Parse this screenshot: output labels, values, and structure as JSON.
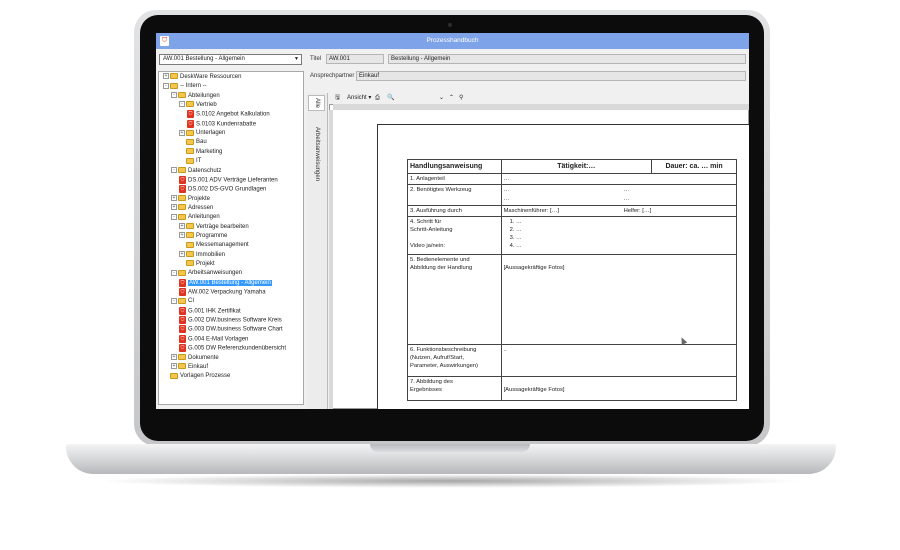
{
  "window": {
    "title": "Prozesshandbuch",
    "app_icon": "app-logo-icon"
  },
  "selector": {
    "value": "AW.001 Bestellung - Allgemein"
  },
  "tree": [
    {
      "label": "DeskWare Ressourcen",
      "type": "folder",
      "expander": "+"
    },
    {
      "label": "-- Intern --",
      "type": "folder",
      "expander": "-"
    },
    {
      "label": "Abteilungen",
      "type": "folder",
      "expander": "-"
    },
    {
      "label": "Vertrieb",
      "type": "folder",
      "expander": "-"
    },
    {
      "label": "S.0102 Angebot Kalkulation",
      "type": "doc"
    },
    {
      "label": "S.0103 Kundenrabatte",
      "type": "doc"
    },
    {
      "label": "Unterlagen",
      "type": "folder",
      "expander": "+"
    },
    {
      "label": "Bau",
      "type": "folder",
      "expander": ""
    },
    {
      "label": "Marketing",
      "type": "folder",
      "expander": ""
    },
    {
      "label": "IT",
      "type": "folder",
      "expander": ""
    },
    {
      "label": "Datenschutz",
      "type": "folder",
      "expander": "-"
    },
    {
      "label": "DS.001 ADV Verträge Lieferanten",
      "type": "doc"
    },
    {
      "label": "DS.002 DS-GVO Grundlagen",
      "type": "doc"
    },
    {
      "label": "Projekte",
      "type": "folder",
      "expander": "+"
    },
    {
      "label": "Adressen",
      "type": "folder",
      "expander": "+"
    },
    {
      "label": "Anleitungen",
      "type": "folder",
      "expander": "-"
    },
    {
      "label": "Verträge bearbeiten",
      "type": "folder",
      "expander": "+"
    },
    {
      "label": "Programme",
      "type": "folder",
      "expander": "+"
    },
    {
      "label": "Messemanagement",
      "type": "folder",
      "expander": ""
    },
    {
      "label": "Immobilien",
      "type": "folder",
      "expander": "+"
    },
    {
      "label": "Projekt",
      "type": "folder",
      "expander": ""
    },
    {
      "label": "Arbeitsanweisungen",
      "type": "folder",
      "expander": "-"
    },
    {
      "label": "AW.001 Bestellung - Allgemein",
      "type": "doc",
      "selected": true
    },
    {
      "label": "AW.002 Verpackung Yamaha",
      "type": "doc"
    },
    {
      "label": "CI",
      "type": "folder",
      "expander": "-"
    },
    {
      "label": "G.001 IHK Zertifikat",
      "type": "doc"
    },
    {
      "label": "G.002 DW.business Software Kreis",
      "type": "doc"
    },
    {
      "label": "G.003 DW.business Software Chart",
      "type": "doc"
    },
    {
      "label": "G.004 E-Mail Vorlagen",
      "type": "doc"
    },
    {
      "label": "G.005 DW Referenzkundenübersicht",
      "type": "doc"
    },
    {
      "label": "Dokumente",
      "type": "folder",
      "expander": "+"
    },
    {
      "label": "Einkauf",
      "type": "folder",
      "expander": "+"
    },
    {
      "label": "Vorlagen Prozesse",
      "type": "folder",
      "expander": ""
    }
  ],
  "details": {
    "title_label": "Titel",
    "code": "AW.001",
    "name": "Bestellung - Allgemein",
    "contact_label": "Ansprechpartner",
    "contact_value": "Einkauf"
  },
  "vtabs": {
    "all": "Alle",
    "instructions": "Arbeitsanweisungen"
  },
  "toolbar": {
    "view": "Ansicht",
    "save_icon": "save-icon",
    "print_icon": "print-icon",
    "preview_icon": "print-preview-icon"
  },
  "form": {
    "header": {
      "col1": "Handlungsanweisung",
      "col2": "Tätigkeit:…",
      "col3": "Dauer: ca.  … min"
    },
    "rows": {
      "r1_label": "1. Anlagenteil",
      "r1_value": "…",
      "r2_label": "2. Benötigtes Werkzeug",
      "r2_v1": "…",
      "r2_v2": "…",
      "r2_v3": "…",
      "r2_v4": "…",
      "r3_label": "3. Ausführung durch",
      "r3_v1": "Maschinenführer: […]",
      "r3_v2": "Helfer: […]",
      "r4_label_a": "4. Schritt für",
      "r4_label_b": "Schritt-Anleitung",
      "r4_label_c": "Video ja/nein:",
      "r4_steps": [
        "1.  …",
        "2.  …",
        "3.  …",
        "4.  …"
      ],
      "r5_label_a": "5. Bedienelemente und",
      "r5_label_b": "Abbildung der Handlung",
      "r5_value": "[Aussagekräftige Fotos]",
      "r6_label_a": "6. Funktionsbeschreibung",
      "r6_label_b": "(Nutzen, Aufruf/Start,",
      "r6_label_c": "Parameter, Auswirkungen)",
      "r6_value": "..",
      "r7_label_a": "7. Abbildung des",
      "r7_label_b": "Ergebnisses",
      "r7_value": "[Aussagekräftige Fotos]"
    }
  }
}
